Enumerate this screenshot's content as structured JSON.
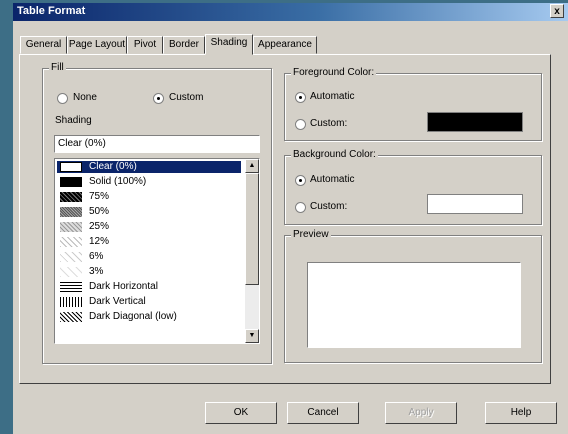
{
  "window": {
    "title": "Table Format",
    "close_glyph": "x"
  },
  "tabs": [
    {
      "label": "General"
    },
    {
      "label": "Page Layout"
    },
    {
      "label": "Pivot"
    },
    {
      "label": "Border"
    },
    {
      "label": "Shading"
    },
    {
      "label": "Appearance"
    }
  ],
  "active_tab": "Shading",
  "fill": {
    "title": "Fill",
    "none_label": "None",
    "custom_label": "Custom",
    "selected": "Custom",
    "shading_label": "Shading",
    "shading_value": "Clear (0%)",
    "items": [
      {
        "label": "Clear (0%)",
        "swatch": "#ffffff",
        "pattern": "clear"
      },
      {
        "label": "Solid (100%)",
        "swatch": "#000000",
        "pattern": "solid"
      },
      {
        "label": "75%",
        "swatch": "#404040",
        "pattern": "p75"
      },
      {
        "label": "50%",
        "swatch": "#808080",
        "pattern": "p50"
      },
      {
        "label": "25%",
        "swatch": "#c0c0c0",
        "pattern": "p25"
      },
      {
        "label": "12%",
        "swatch": "#dcdcdc",
        "pattern": "p12"
      },
      {
        "label": "6%",
        "swatch": "#ececec",
        "pattern": "p6"
      },
      {
        "label": "3%",
        "swatch": "#f6f6f6",
        "pattern": "p3"
      },
      {
        "label": "Dark Horizontal",
        "swatch": "#000000",
        "pattern": "hz"
      },
      {
        "label": "Dark Vertical",
        "swatch": "#000000",
        "pattern": "vt"
      },
      {
        "label": "Dark Diagonal (low)",
        "swatch": "#000000",
        "pattern": "dg"
      }
    ],
    "selected_item": "Clear (0%)"
  },
  "foreground": {
    "title": "Foreground Color:",
    "automatic_label": "Automatic",
    "custom_label": "Custom:",
    "selected": "Automatic",
    "color": "#000000"
  },
  "background": {
    "title": "Background Color:",
    "automatic_label": "Automatic",
    "custom_label": "Custom:",
    "selected": "Automatic",
    "color": "#ffffff"
  },
  "preview": {
    "title": "Preview"
  },
  "buttons": {
    "ok": "OK",
    "cancel": "Cancel",
    "apply": "Apply",
    "help": "Help"
  }
}
